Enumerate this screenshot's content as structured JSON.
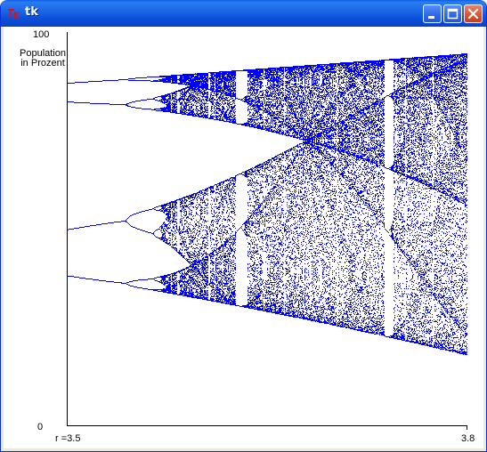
{
  "window": {
    "title": "tk"
  },
  "plot": {
    "y_max_label": "100",
    "y_min_label": "0",
    "y_title_line1": "Population",
    "y_title_line2": "in Prozent",
    "x_min_label": "r =3.5",
    "x_max_label": "3.8",
    "color": "#0000ff",
    "r_min": 3.5,
    "r_max": 3.8,
    "y_min": 0,
    "y_max": 100
  }
}
